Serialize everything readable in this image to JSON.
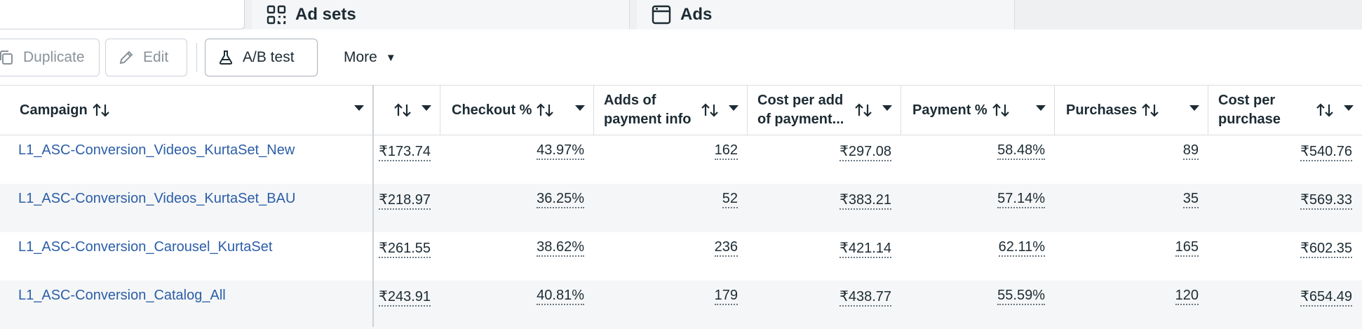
{
  "tabs": {
    "adsets_label": "Ad sets",
    "ads_label": "Ads"
  },
  "toolbar": {
    "duplicate_label": "Duplicate",
    "edit_label": "Edit",
    "abtest_label": "A/B test",
    "more_label": "More"
  },
  "columns": [
    {
      "label": "Campaign"
    },
    {
      "label": ""
    },
    {
      "label": "Checkout %"
    },
    {
      "label": "Adds of payment info"
    },
    {
      "label": "Cost per add of payment..."
    },
    {
      "label": "Payment %"
    },
    {
      "label": "Purchases"
    },
    {
      "label": "Cost per purchase"
    }
  ],
  "rows": [
    {
      "campaign": "L1_ASC-Conversion_Videos_KurtaSet_New",
      "cells": [
        "₹173.74",
        "43.97%",
        "162",
        "₹297.08",
        "58.48%",
        "89",
        "₹540.76"
      ]
    },
    {
      "campaign": "L1_ASC-Conversion_Videos_KurtaSet_BAU",
      "cells": [
        "₹218.97",
        "36.25%",
        "52",
        "₹383.21",
        "57.14%",
        "35",
        "₹569.33"
      ]
    },
    {
      "campaign": "L1_ASC-Conversion_Carousel_KurtaSet",
      "cells": [
        "₹261.55",
        "38.62%",
        "236",
        "₹421.14",
        "62.11%",
        "165",
        "₹602.35"
      ]
    },
    {
      "campaign": "L1_ASC-Conversion_Catalog_All",
      "cells": [
        "₹243.91",
        "40.81%",
        "179",
        "₹438.77",
        "55.59%",
        "120",
        "₹654.49"
      ]
    }
  ]
}
